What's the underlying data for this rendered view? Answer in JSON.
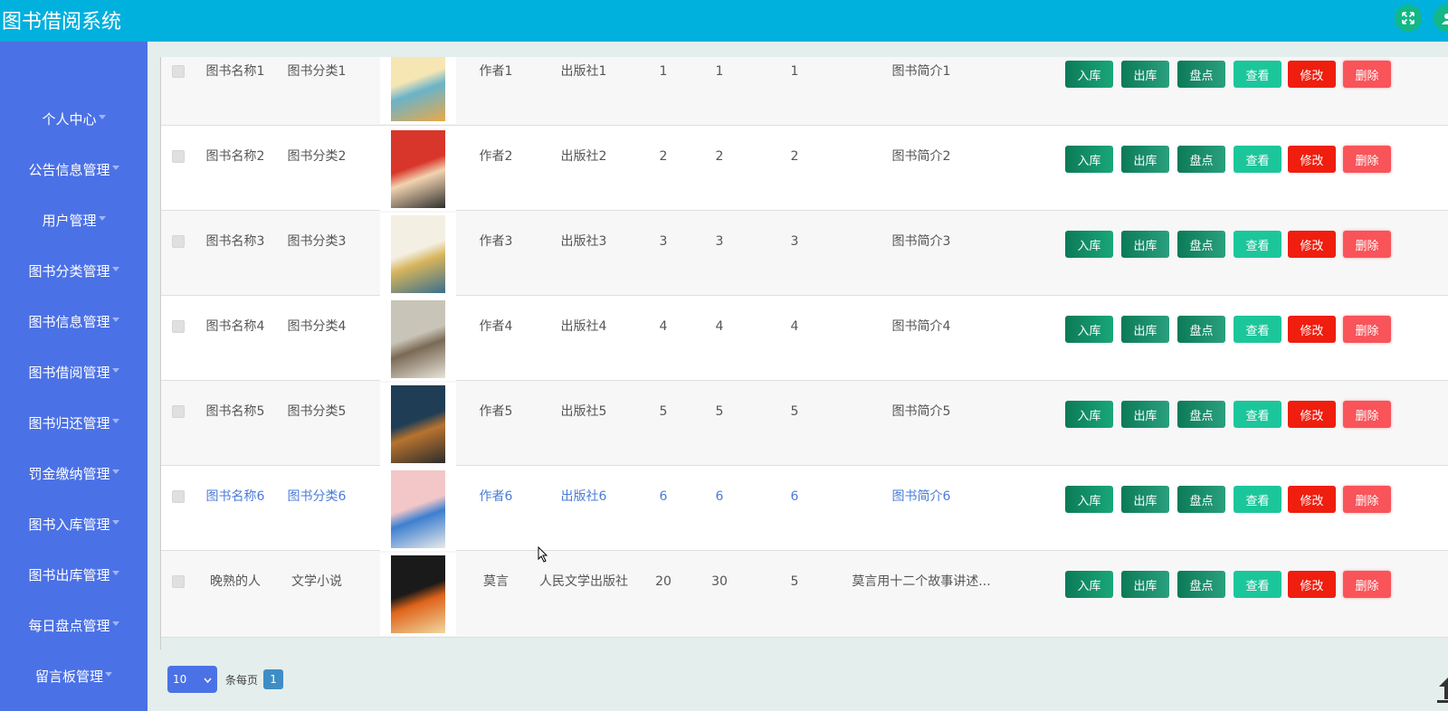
{
  "app": {
    "title": "图书借阅系统"
  },
  "sidebar": {
    "items": [
      {
        "label": "个人中心"
      },
      {
        "label": "公告信息管理"
      },
      {
        "label": "用户管理"
      },
      {
        "label": "图书分类管理"
      },
      {
        "label": "图书信息管理"
      },
      {
        "label": "图书借阅管理"
      },
      {
        "label": "图书归还管理"
      },
      {
        "label": "罚金缴纳管理"
      },
      {
        "label": "图书入库管理"
      },
      {
        "label": "图书出库管理"
      },
      {
        "label": "每日盘点管理"
      },
      {
        "label": "留言板管理"
      }
    ]
  },
  "actions": {
    "in": "入库",
    "out": "出库",
    "check": "盘点",
    "view": "查看",
    "edit": "修改",
    "del": "删除"
  },
  "rows": [
    {
      "name": "图书名称1",
      "category": "图书分类1",
      "author": "作者1",
      "publisher": "出版社1",
      "a": "1",
      "b": "1",
      "c": "1",
      "intro": "图书简介1"
    },
    {
      "name": "图书名称2",
      "category": "图书分类2",
      "author": "作者2",
      "publisher": "出版社2",
      "a": "2",
      "b": "2",
      "c": "2",
      "intro": "图书简介2"
    },
    {
      "name": "图书名称3",
      "category": "图书分类3",
      "author": "作者3",
      "publisher": "出版社3",
      "a": "3",
      "b": "3",
      "c": "3",
      "intro": "图书简介3"
    },
    {
      "name": "图书名称4",
      "category": "图书分类4",
      "author": "作者4",
      "publisher": "出版社4",
      "a": "4",
      "b": "4",
      "c": "4",
      "intro": "图书简介4"
    },
    {
      "name": "图书名称5",
      "category": "图书分类5",
      "author": "作者5",
      "publisher": "出版社5",
      "a": "5",
      "b": "5",
      "c": "5",
      "intro": "图书简介5"
    },
    {
      "name": "图书名称6",
      "category": "图书分类6",
      "author": "作者6",
      "publisher": "出版社6",
      "a": "6",
      "b": "6",
      "c": "6",
      "intro": "图书简介6"
    },
    {
      "name": "晚熟的人",
      "category": "文学小说",
      "author": "莫言",
      "publisher": "人民文学出版社",
      "a": "20",
      "b": "30",
      "c": "5",
      "intro": "莫言用十二个故事讲述..."
    }
  ],
  "pagination": {
    "page_size": "10",
    "per_page_label": "条每页",
    "current_page": "1"
  },
  "colors": {
    "topbar": "#00b0dd",
    "sidebar": "#4b71e6",
    "edit": "#ef1e0f",
    "delete": "#f8545a",
    "view": "#1cc69b"
  }
}
